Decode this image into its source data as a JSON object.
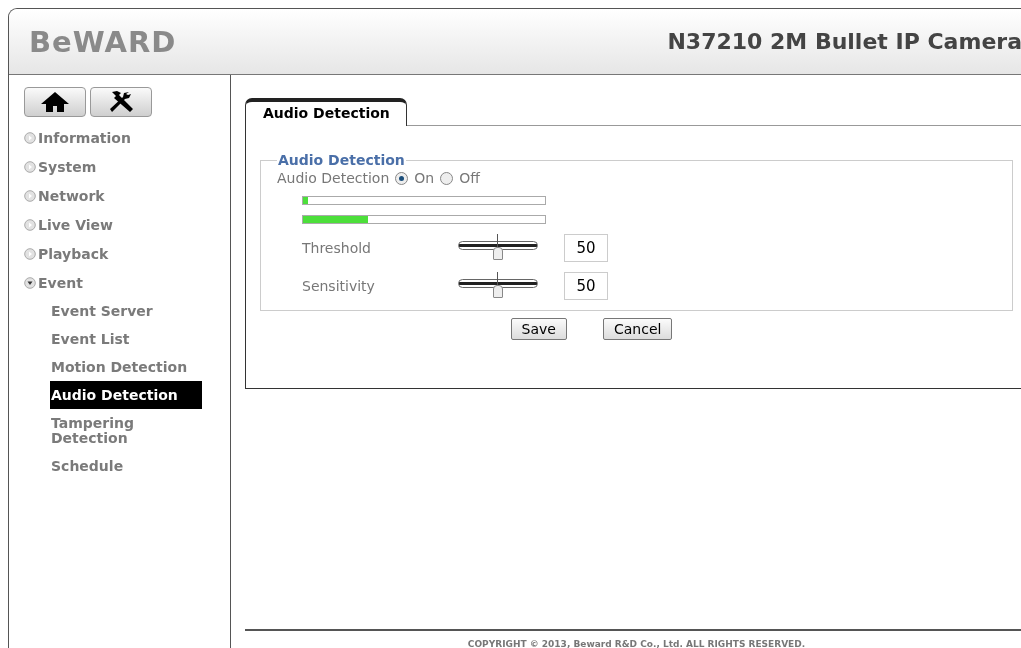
{
  "header": {
    "logo": "BeWARD",
    "title": "N37210 2M Bullet IP Camera"
  },
  "menu": [
    {
      "label": "Information",
      "expanded": false
    },
    {
      "label": "System",
      "expanded": false
    },
    {
      "label": "Network",
      "expanded": false
    },
    {
      "label": "Live View",
      "expanded": false
    },
    {
      "label": "Playback",
      "expanded": false
    },
    {
      "label": "Event",
      "expanded": true,
      "children": [
        {
          "label": "Event Server",
          "selected": false
        },
        {
          "label": "Event List",
          "selected": false
        },
        {
          "label": "Motion Detection",
          "selected": false
        },
        {
          "label": "Audio Detection",
          "selected": true
        },
        {
          "label": "Tampering Detection",
          "selected": false
        },
        {
          "label": "Schedule",
          "selected": false
        }
      ]
    }
  ],
  "tab": {
    "label": "Audio Detection"
  },
  "section": {
    "legend": "Audio Detection",
    "mode": {
      "label": "Audio Detection",
      "options": [
        {
          "label": "On",
          "selected": true
        },
        {
          "label": "Off",
          "selected": false
        }
      ]
    },
    "meters": [
      {
        "level": 0.02
      },
      {
        "level": 0.27
      }
    ],
    "sliders": [
      {
        "label": "Threshold",
        "level": 0.5,
        "value": "50"
      },
      {
        "label": "Sensitivity",
        "level": 0.5,
        "value": "50"
      }
    ]
  },
  "buttons": [
    "Save",
    "Cancel"
  ],
  "footer": "COPYRIGHT © 2013, Beward R&D Co., Ltd. ALL RIGHTS RESERVED."
}
